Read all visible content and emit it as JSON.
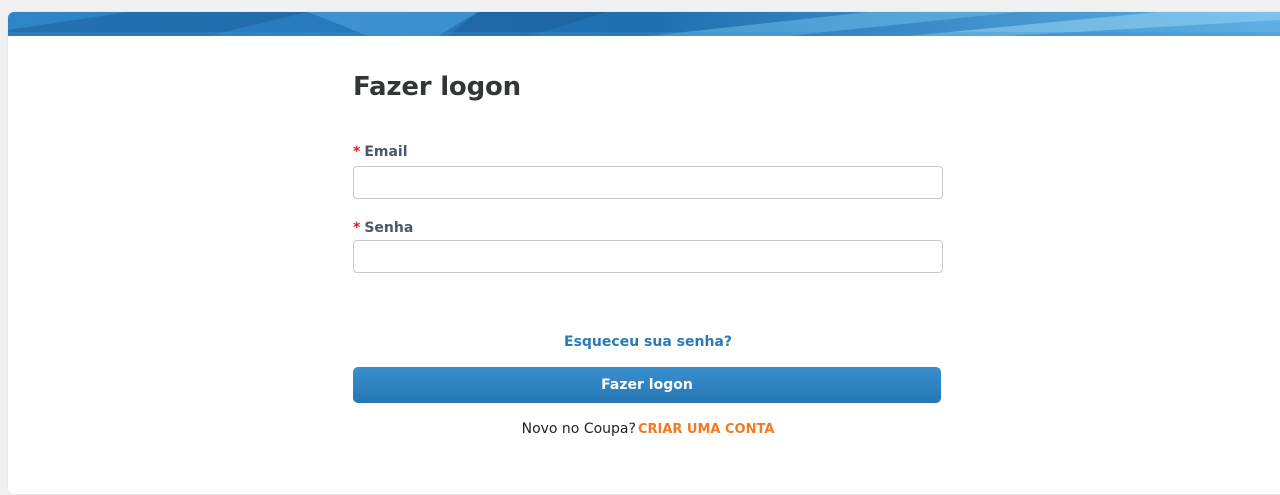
{
  "page": {
    "title": "Fazer logon"
  },
  "form": {
    "required_marker": "*",
    "email": {
      "label": "Email",
      "value": "",
      "placeholder": ""
    },
    "password": {
      "label": "Senha",
      "value": "",
      "placeholder": ""
    },
    "forgot_password_link": "Esqueceu sua senha?",
    "submit_label": "Fazer logon"
  },
  "signup": {
    "prompt": "Novo no Coupa?",
    "link_label": "CRIAR UMA CONTA"
  },
  "colors": {
    "banner_dark": "#1f6fb0",
    "banner_light": "#5fb0e3",
    "primary_button": "#2b80c0",
    "link_blue": "#2a7ab5",
    "required_red": "#e0201f",
    "signup_orange": "#f27a21"
  }
}
